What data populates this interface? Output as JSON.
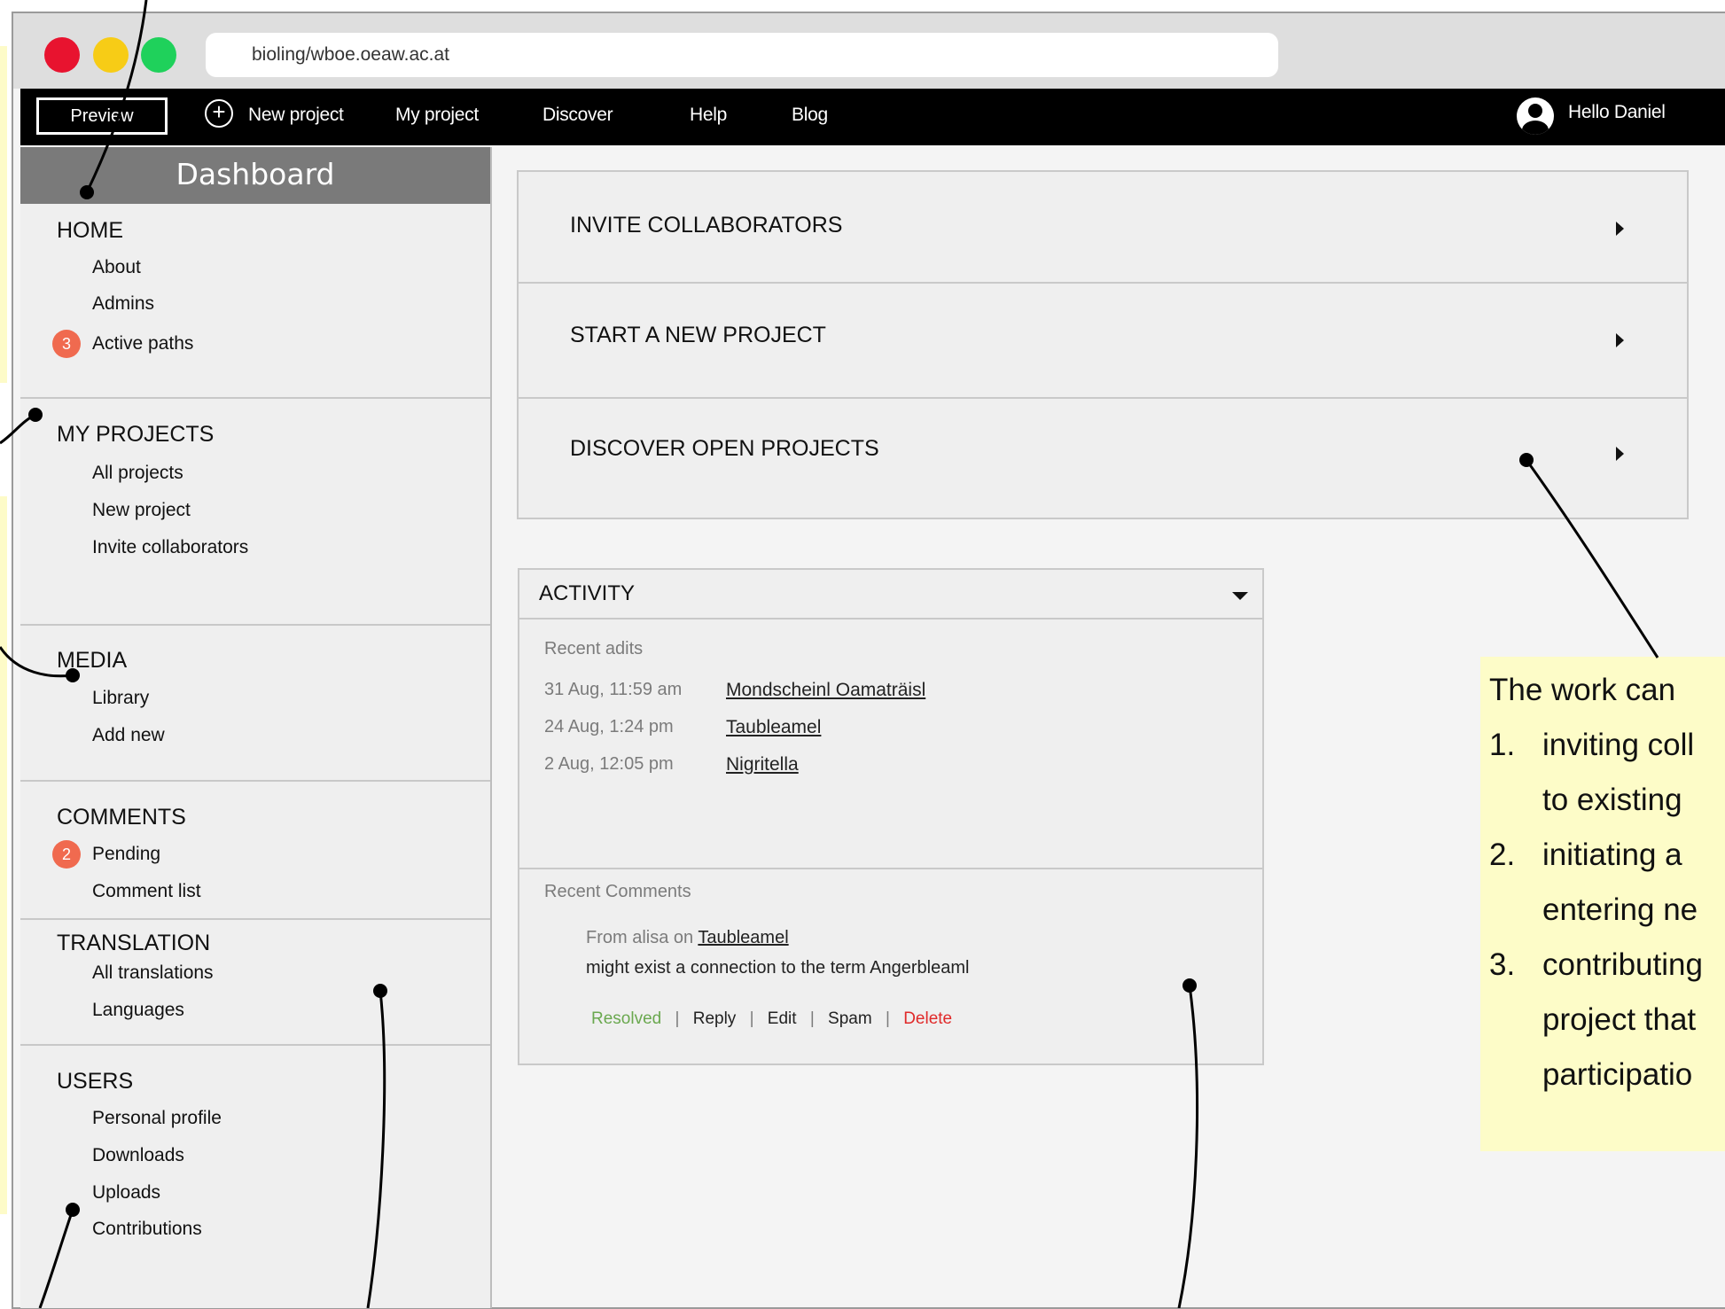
{
  "browser": {
    "url": "bioling/wboe.oeaw.ac.at",
    "traffic_lights": [
      "#e8132f",
      "#f7cc16",
      "#1fd15b"
    ]
  },
  "topnav": {
    "preview": "Preview",
    "new_project": "New project",
    "my_project": "My project",
    "discover": "Discover",
    "help": "Help",
    "blog": "Blog",
    "greeting": "Hello Daniel"
  },
  "sidebar": {
    "header": "Dashboard",
    "sections": {
      "home": {
        "title": "HOME",
        "items": [
          "About",
          "Admins",
          "Active paths"
        ],
        "badge": "3"
      },
      "projects": {
        "title": "MY PROJECTS",
        "items": [
          "All projects",
          "New project",
          "Invite collaborators"
        ]
      },
      "media": {
        "title": "MEDIA",
        "items": [
          "Library",
          "Add new"
        ]
      },
      "comments": {
        "title": "COMMENTS",
        "items": [
          "Pending",
          "Comment list"
        ],
        "badge": "2"
      },
      "translation": {
        "title": "TRANSLATION",
        "items": [
          "All translations",
          "Languages"
        ]
      },
      "users": {
        "title": "USERS",
        "items": [
          "Personal profile",
          "Downloads",
          "Uploads",
          "Contributions"
        ]
      }
    }
  },
  "actions": [
    "INVITE COLLABORATORS",
    "START A NEW PROJECT",
    "DISCOVER OPEN PROJECTS"
  ],
  "activity": {
    "title": "ACTIVITY",
    "recent_edits_label": "Recent adits",
    "edits": [
      {
        "time": "31 Aug, 11:59 am",
        "title": "Mondscheinl Oamaträisl"
      },
      {
        "time": "24 Aug, 1:24 pm",
        "title": "Taubleamel"
      },
      {
        "time": "2 Aug, 12:05 pm",
        "title": "Nigritella"
      }
    ],
    "recent_comments_label": "Recent Comments",
    "comment": {
      "from_prefix": "From alisa on",
      "target": "Taubleamel",
      "text": "might exist a connection to the term Angerbleaml"
    },
    "comment_actions": {
      "resolved": "Resolved",
      "reply": "Reply",
      "edit": "Edit",
      "spam": "Spam",
      "delete": "Delete",
      "separator": "|"
    }
  },
  "annotation": {
    "lines": [
      "The work can",
      "inviting coll",
      "to existing",
      "initiating a",
      "entering ne",
      "contributing",
      "project that",
      "participatio"
    ],
    "numbers": [
      "1.",
      "2.",
      "3."
    ]
  },
  "colors": {
    "nav_bg": "#000000",
    "sidebar_header": "#7a7a7a",
    "badge": "#f06a4f",
    "resolved": "#6aa84f",
    "delete": "#e02a2a",
    "note_bg": "#fdfcc8"
  }
}
